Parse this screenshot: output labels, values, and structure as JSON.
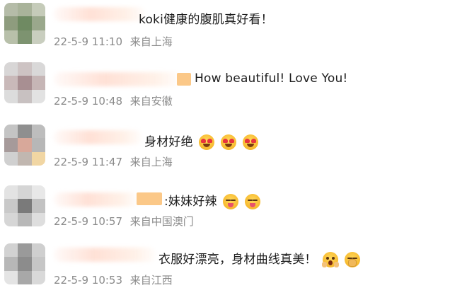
{
  "comments": [
    {
      "text": "koki健康的腹肌真好看！",
      "date": "22-5-9",
      "time": "11:10",
      "location": "来自上海",
      "emojis": []
    },
    {
      "text": "How beautiful! Love You!",
      "date": "22-5-9",
      "time": "10:48",
      "location": "来自安徽",
      "emojis": []
    },
    {
      "text": "身材好绝",
      "date": "22-5-9",
      "time": "11:47",
      "location": "来自上海",
      "emojis": [
        "heart-eyes-emoji",
        "heart-eyes-emoji",
        "heart-eyes-emoji"
      ]
    },
    {
      "text": ":妹妹好辣",
      "date": "22-5-9",
      "time": "10:57",
      "location": "来自中国澳门",
      "emojis": [
        "tongue-emoji",
        "tongue-emoji"
      ]
    },
    {
      "text": "衣服好漂亮，身材曲线真美！",
      "date": "22-5-9",
      "time": "10:53",
      "location": "来自江西",
      "emojis": [
        "scream-emoji",
        "hushed-hands-emoji"
      ]
    }
  ]
}
